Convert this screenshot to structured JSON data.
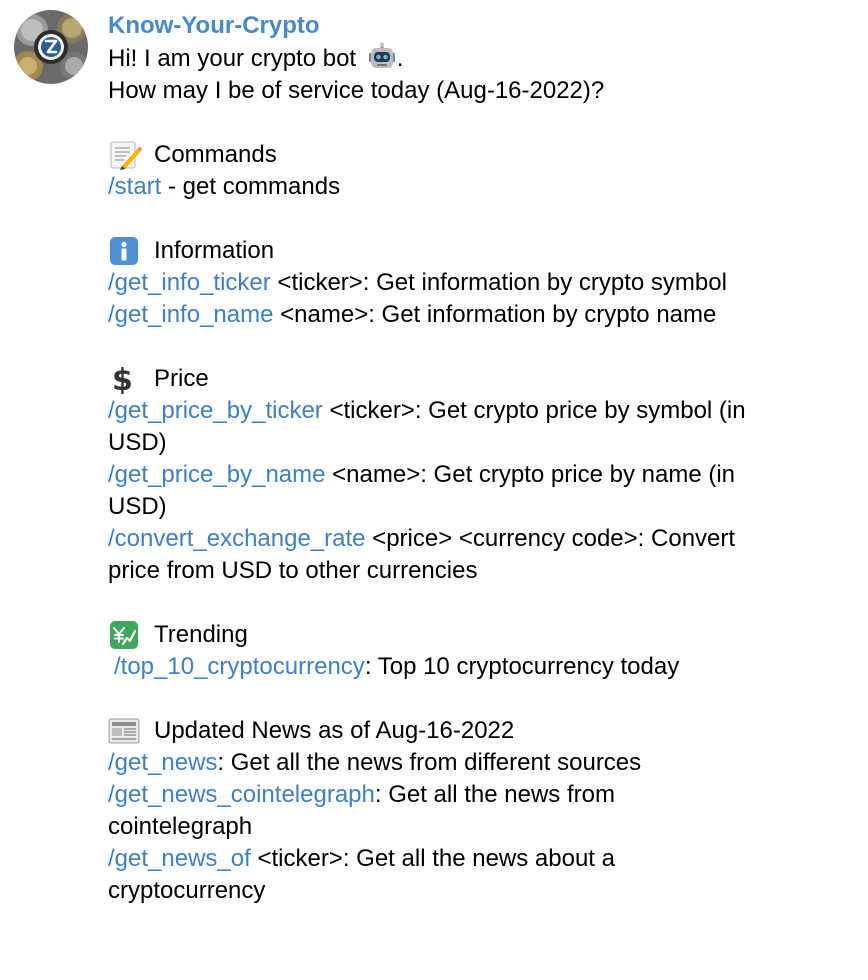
{
  "sender": "Know-Your-Crypto",
  "greeting": {
    "line1": "Hi! I am your crypto bot",
    "line1_end": ".",
    "line2": "How may I be of service today (Aug-16-2022)?"
  },
  "sections": {
    "commands": {
      "icon": "memo-icon",
      "title": "Commands",
      "items": [
        {
          "cmd": "/start",
          "desc": " - get commands"
        }
      ]
    },
    "information": {
      "icon": "info-icon",
      "title": "Information",
      "items": [
        {
          "cmd": "/get_info_ticker",
          "desc": " <ticker>: Get information by crypto symbol"
        },
        {
          "cmd": "/get_info_name",
          "desc": " <name>: Get information by crypto name"
        }
      ]
    },
    "price": {
      "icon": "dollar-icon",
      "title": "Price",
      "items": [
        {
          "cmd": "/get_price_by_ticker",
          "desc": " <ticker>: Get crypto price by symbol (in",
          "desc2": "USD)"
        },
        {
          "cmd": "/get_price_by_name",
          "desc": " <name>: Get crypto price by name (in",
          "desc2": "USD)"
        },
        {
          "cmd": "/convert_exchange_rate",
          "desc": " <price> <currency code>: Convert",
          "desc2": "price from USD to other currencies"
        }
      ]
    },
    "trending": {
      "icon": "chart-yen-icon",
      "title": "Trending",
      "items": [
        {
          "cmd": "/top_10_cryptocurrency",
          "desc": ": Top 10 cryptocurrency today"
        }
      ]
    },
    "news": {
      "icon": "newspaper-icon",
      "title": "Updated News as of Aug-16-2022",
      "items": [
        {
          "cmd": "/get_news",
          "desc": ": Get all the news from different sources"
        },
        {
          "cmd": "/get_news_cointelegraph",
          "desc": ": Get all the news from",
          "desc2": "cointelegraph"
        },
        {
          "cmd": "/get_news_of",
          "desc": " <ticker>: Get all the news about a",
          "desc2": "cryptocurrency"
        }
      ]
    }
  },
  "colors": {
    "sender": "#4a89c8",
    "link": "#3f7fc4",
    "text": "#000000"
  }
}
